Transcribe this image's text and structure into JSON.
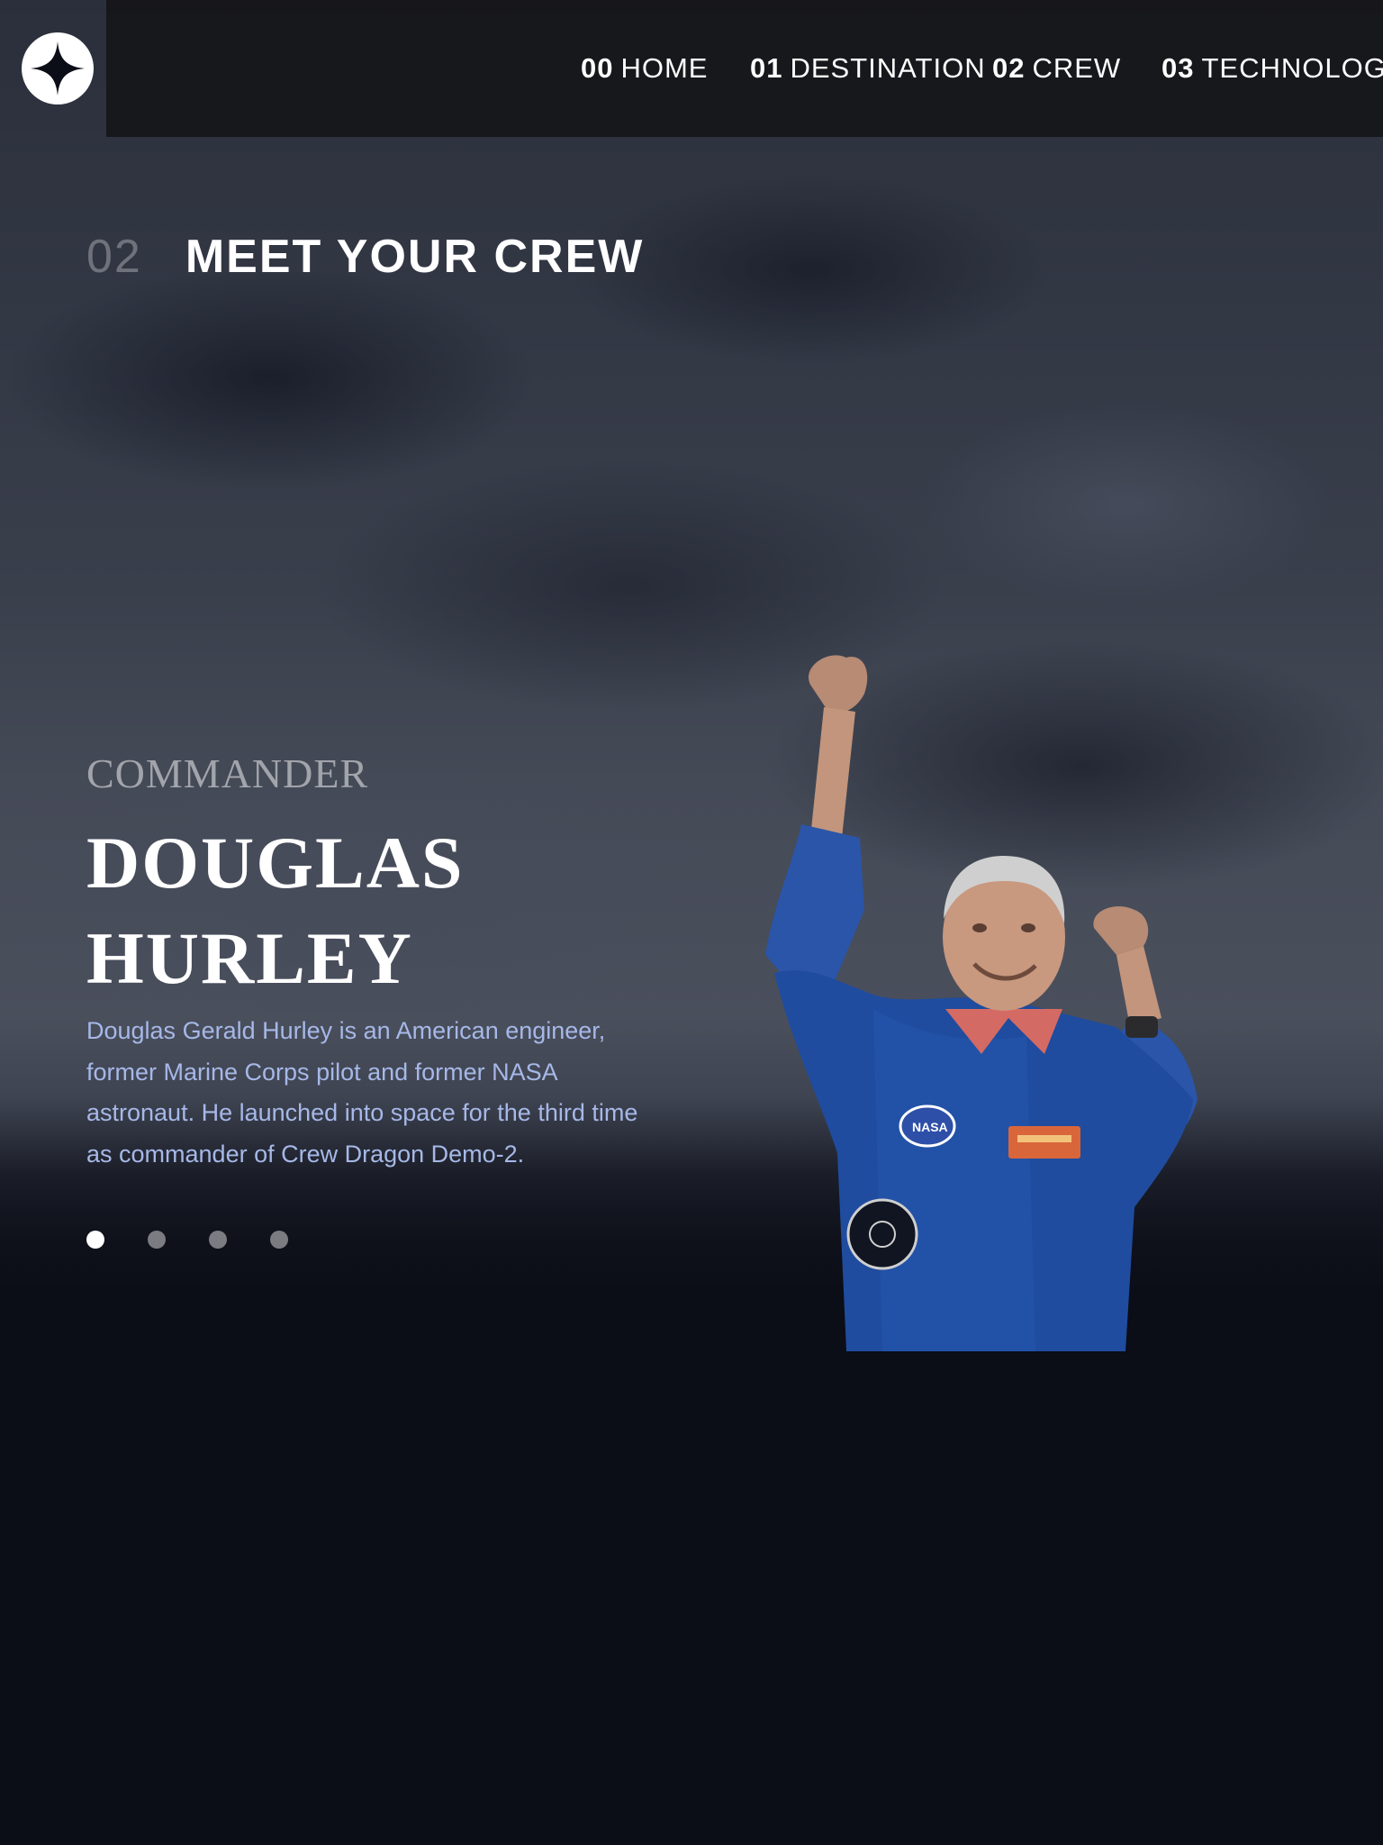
{
  "nav": {
    "items": [
      {
        "num": "00",
        "label": "HOME"
      },
      {
        "num": "01",
        "label": "DESTINATION"
      },
      {
        "num": "02",
        "label": "CREW"
      },
      {
        "num": "03",
        "label": "TECHNOLOGY"
      }
    ]
  },
  "page": {
    "number": "02",
    "heading": "MEET YOUR CREW"
  },
  "crew": {
    "role": "COMMANDER",
    "name_line1": "DOUGLAS",
    "name_line2": "HURLEY",
    "bio": "Douglas Gerald Hurley is an American engineer, former Marine Corps pilot and former NASA astronaut. He launched into space for the third time as commander of Crew Dragon Demo-2.",
    "slides": 4,
    "active_slide": 1
  },
  "colors": {
    "background": "#0b0d17",
    "accent_text": "#a6b8e8",
    "nav_bar": "#16161a"
  }
}
